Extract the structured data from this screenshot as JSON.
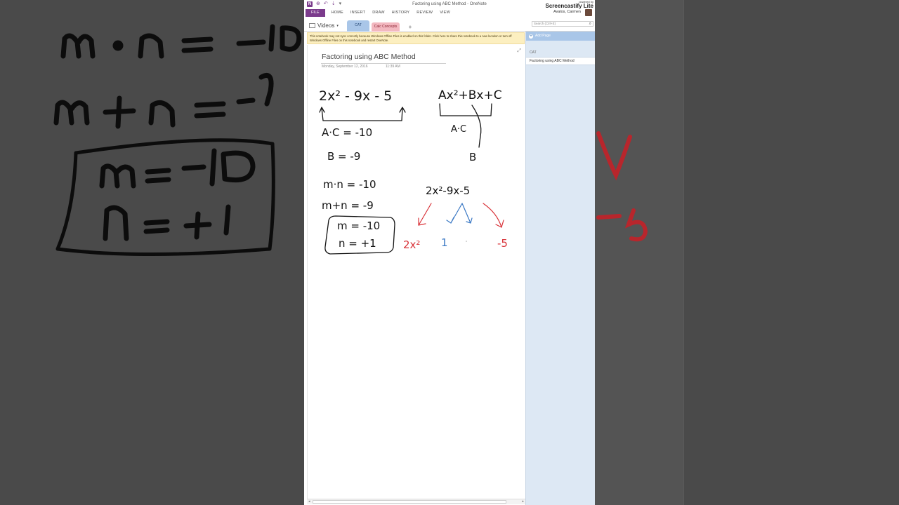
{
  "window": {
    "title": "Factoring using ABC Method - OneNote",
    "logo": "N",
    "watermark_small": "powered by",
    "watermark_big": "Screencastify Lite"
  },
  "ribbon": {
    "tabs": [
      "FILE",
      "HOME",
      "INSERT",
      "DRAW",
      "HISTORY",
      "REVIEW",
      "VIEW"
    ],
    "user": "Avalos, Carmen"
  },
  "notebook": {
    "name": "Videos",
    "sections": [
      "CAT",
      "Calc Concepts"
    ],
    "add_section": "+",
    "search_placeholder": "Search (Ctrl+E)"
  },
  "warning": "This notebook may not sync correctly because Windows Offline Files is enabled on this folder. Click here to share this notebook to a new location or turn off Windows Offline Files on this notebook and restart OneNote.",
  "page": {
    "title": "Factoring using ABC Method",
    "date": "Monday, September 12, 2016",
    "time": "11:39 AM",
    "ink": {
      "expr_main": "2x² - 9x - 5",
      "ac_line": "A·C = -10",
      "b_line": "B = -9",
      "general_form": "Ax²+Bx+C",
      "general_ac": "A·C",
      "general_b": "B",
      "mn_product": "m·n = -10",
      "mn_sum": "m+n = -9",
      "box_m": "m = -10",
      "box_n": "n = +1",
      "expr_split": "2x²-9x-5",
      "split_first": "2x²",
      "split_middle": "1",
      "split_last": "-5"
    }
  },
  "pages_pane": {
    "add_page": "Add Page",
    "section_label": "CAT",
    "pages": [
      "Factoring using ABC Method"
    ]
  },
  "colors": {
    "onenote_purple": "#7b3b8c",
    "ink_red": "#d9343a",
    "ink_blue": "#3a78c4",
    "pane_blue": "#dde8f4"
  }
}
